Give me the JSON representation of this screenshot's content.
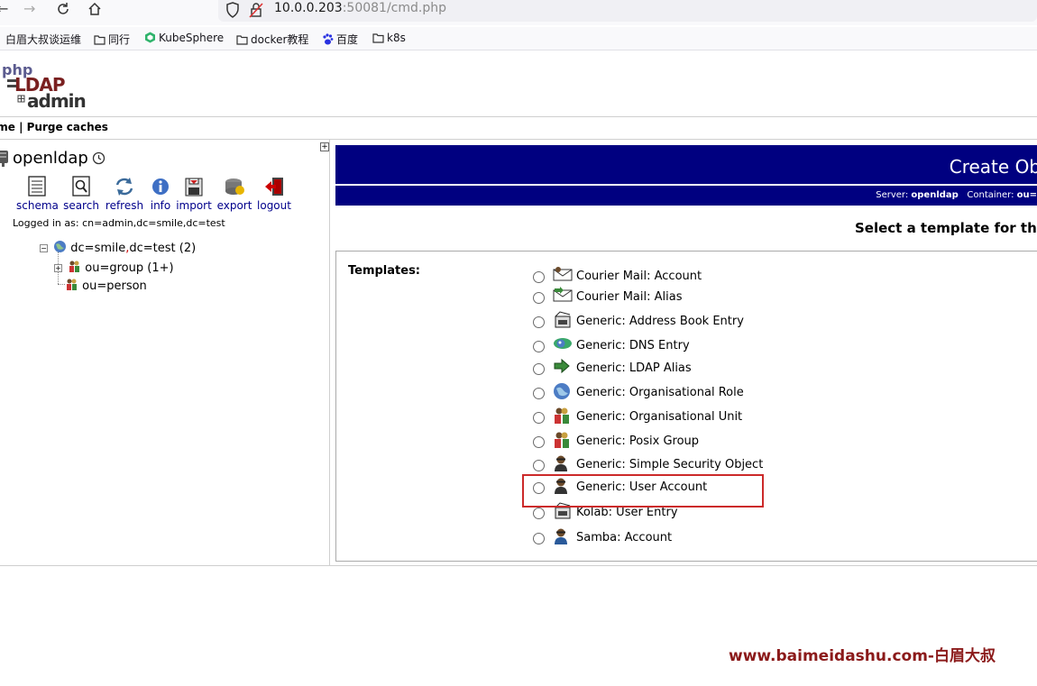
{
  "browser": {
    "url_host": "10.0.0.203",
    "url_rest": ":50081/cmd.php",
    "bookmarks": [
      {
        "label": "白眉大叔谈运维",
        "icon": "none"
      },
      {
        "label": "同行",
        "icon": "folder-icon"
      },
      {
        "label": "KubeSphere",
        "icon": "kubesphere-icon"
      },
      {
        "label": "docker教程",
        "icon": "folder-icon"
      },
      {
        "label": "百度",
        "icon": "baidu-icon"
      },
      {
        "label": "k8s",
        "icon": "folder-icon"
      }
    ]
  },
  "header": {
    "logo_php": "php",
    "logo_ldap": "LDAP",
    "logo_admin": "admin",
    "menu_text": "ome | Purge caches"
  },
  "tree": {
    "expand_glyph": "+",
    "server": "openldap",
    "actions": [
      {
        "label": "schema",
        "icon": "schema-icon"
      },
      {
        "label": "search",
        "icon": "search-icon"
      },
      {
        "label": "refresh",
        "icon": "refresh-icon"
      },
      {
        "label": "info",
        "icon": "info-icon"
      },
      {
        "label": "import",
        "icon": "import-icon"
      },
      {
        "label": "export",
        "icon": "export-icon"
      },
      {
        "label": "logout",
        "icon": "logout-icon"
      }
    ],
    "logged_in": "Logged in as: cn=admin,dc=smile,dc=test",
    "root": {
      "label_a": "dc=smile",
      "sep": ",",
      "label_b": "dc=test (2)",
      "toggle": "−"
    },
    "children": [
      {
        "label": "ou=group (1+)",
        "toggle": "+"
      },
      {
        "label": "ou=person",
        "toggle": ""
      }
    ]
  },
  "main": {
    "title": "Create Ob",
    "server_label": "Server:",
    "server_value": "openldap",
    "container_label": "Container:",
    "container_value": "ou=",
    "select_title": "Select a template for th",
    "templates_label": "Templates:",
    "templates": [
      {
        "label": "Courier Mail: Account",
        "icon": "mail-account-icon"
      },
      {
        "label": "Courier Mail: Alias",
        "icon": "mail-alias-icon"
      },
      {
        "label": "Generic: Address Book Entry",
        "icon": "address-book-icon"
      },
      {
        "label": "Generic: DNS Entry",
        "icon": "dns-icon"
      },
      {
        "label": "Generic: LDAP Alias",
        "icon": "alias-arrow-icon"
      },
      {
        "label": "Generic: Organisational Role",
        "icon": "globe-icon"
      },
      {
        "label": "Generic: Organisational Unit",
        "icon": "ou-icon"
      },
      {
        "label": "Generic: Posix Group",
        "icon": "group-icon"
      },
      {
        "label": "Generic: Simple Security Object",
        "icon": "user-icon"
      },
      {
        "label": "Generic: User Account",
        "icon": "user-icon"
      },
      {
        "label": "Kolab: User Entry",
        "icon": "address-book-icon"
      },
      {
        "label": "Samba: Account",
        "icon": "user-icon"
      }
    ]
  },
  "watermark": "www.baimeidashu.com-白眉大叔",
  "colors": {
    "header_blue": "#000080",
    "link_blue": "#00008b",
    "highlight_red": "#cc2a2a",
    "watermark": "#8b1a1a"
  }
}
